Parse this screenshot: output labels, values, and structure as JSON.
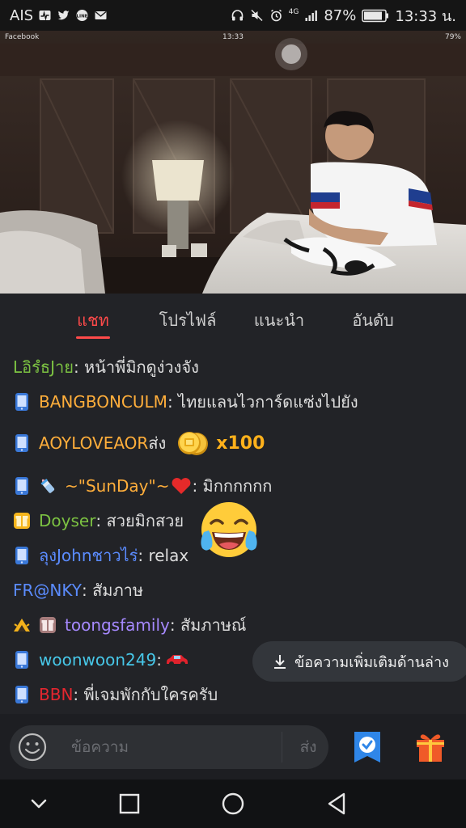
{
  "status_bar": {
    "carrier": "AIS",
    "network": "4G",
    "battery": "87%",
    "time": "13:33 น."
  },
  "video": {
    "inner_app": "Facebook",
    "inner_time": "13:33",
    "inner_battery": "79%"
  },
  "tabs": [
    {
      "label": "แชท",
      "active": true
    },
    {
      "label": "โปรไฟล์",
      "active": false
    },
    {
      "label": "แนะนำ",
      "active": false
    },
    {
      "label": "อันดับ",
      "active": false
    }
  ],
  "chat": {
    "messages": [
      {
        "name": "LอิรํธJาย",
        "text": ": หน้าพี่มิกดูง่วงจัง"
      },
      {
        "name": "BANGBONCULM",
        "text": ": ไทยแลนไวการ์ดแซ่งไปยัง"
      },
      {
        "name": "AOYLOVEAOR",
        "text": " ส่ง",
        "gift_amount": "x100"
      },
      {
        "name": "~\"SunDay\"~",
        "text": ": มิกกกกกก"
      },
      {
        "name": "Doyser",
        "text": ": สวยมิกสวย"
      },
      {
        "name": "ลุงJohnชาวไร่",
        "text": ": relax"
      },
      {
        "name": "FR@NKY",
        "text": ": สัมภาษ"
      },
      {
        "name": "toongsfamily",
        "text": ": สัมภาษณ์"
      },
      {
        "name": "woonwoon249",
        "text": ": "
      },
      {
        "name": "BBN",
        "text": ": พี่เจมพักกับใครครับ"
      }
    ],
    "more_below": "ข้อความเพิ่มเติมด้านล่าง"
  },
  "input": {
    "placeholder": "ข้อความ",
    "send_label": "ส่ง"
  },
  "colors": {
    "accent": "#ff4a4a",
    "background": "#222327",
    "name_green": "#7cc242",
    "name_orange": "#ffae3b",
    "name_blue": "#5b8cff",
    "name_cyan": "#47c7e8",
    "name_purple": "#a689ff",
    "name_red": "#e3262f"
  }
}
